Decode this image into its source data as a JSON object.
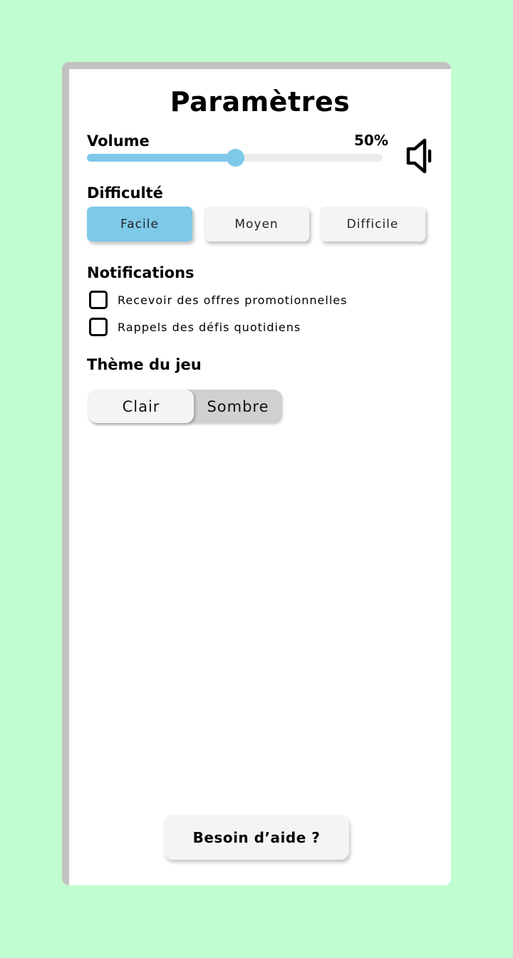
{
  "header": {
    "title": "Paramètres"
  },
  "volume": {
    "label": "Volume",
    "value_text": "50%",
    "level": 0.5,
    "icon": "speaker-icon"
  },
  "difficulty": {
    "label": "Difficulté",
    "options": [
      "Facile",
      "Moyen",
      "Difficile"
    ],
    "selected": "Facile"
  },
  "notifications": {
    "label": "Notifications",
    "items": [
      {
        "label": "Recevoir des offres promotionnelles",
        "checked": false
      },
      {
        "label": "Rappels des défis quotidiens",
        "checked": false
      }
    ]
  },
  "theme": {
    "label": "Thème du jeu",
    "options": [
      "Clair",
      "Sombre"
    ],
    "selected": "Clair"
  },
  "help": {
    "label": "Besoin d’aide ?"
  },
  "colors": {
    "background": "#c0fdd0",
    "accent": "#7ec8e8",
    "card": "#ffffff",
    "button": "#f4f4f4"
  }
}
